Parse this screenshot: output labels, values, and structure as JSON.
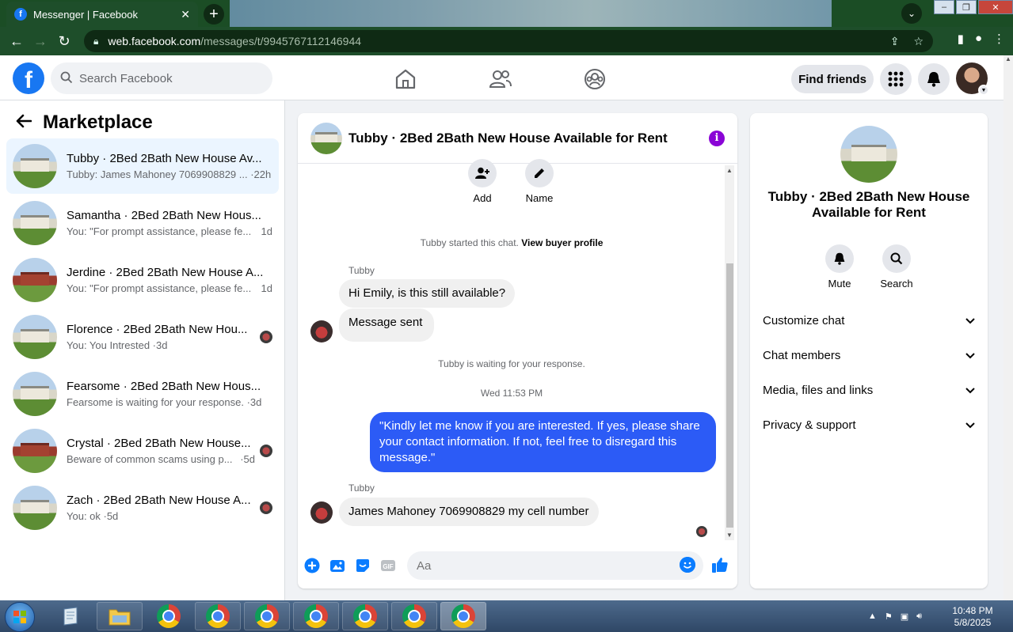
{
  "browser": {
    "tab_title": "Messenger | Facebook",
    "tab_favicon": "f",
    "url_host": "web.facebook.com",
    "url_path": "/messages/t/9945767112146944"
  },
  "fb_header": {
    "search_placeholder": "Search Facebook",
    "find_friends": "Find friends"
  },
  "sidebar": {
    "title": "Marketplace",
    "chats": [
      {
        "name": "Tubby · 2Bed 2Bath New House Av...",
        "preview": "Tubby: James Mahoney 7069908829 ... ·22h"
      },
      {
        "name": "Samantha · 2Bed 2Bath New Hous...",
        "preview": "You: \"For prompt assistance, please fe...",
        "time": "1d"
      },
      {
        "name": "Jerdine · 2Bed 2Bath New House A...",
        "preview": "You: \"For prompt assistance, please fe...",
        "time": "1d"
      },
      {
        "name": "Florence · 2Bed 2Bath New Hou...",
        "preview": "You: You Intrested ·3d"
      },
      {
        "name": "Fearsome · 2Bed 2Bath New Hous...",
        "preview": "Fearsome is waiting for your response. ·3d"
      },
      {
        "name": "Crystal · 2Bed 2Bath New House...",
        "preview": "Beware of common scams using p...",
        "time": "·5d"
      },
      {
        "name": "Zach · 2Bed 2Bath New House A...",
        "preview": "You: ok ·5d"
      }
    ]
  },
  "chat": {
    "title": "Tubby · 2Bed 2Bath New House Available for Rent",
    "add_label": "Add",
    "name_label": "Name",
    "started_text": "Tubby started this chat.",
    "buyer_profile": "View buyer profile",
    "sender1": "Tubby",
    "msg1": "Hi Emily, is this still available?",
    "msg2": "Message sent",
    "waiting": "Tubby is waiting for your response.",
    "timestamp": "Wed 11:53 PM",
    "out_msg": "\"Kindly let me know if you are interested. If yes, please share your contact information. If not, feel free to disregard this message.\"",
    "sender2": "Tubby",
    "msg3": "James Mahoney 7069908829 my cell number",
    "composer_placeholder": "Aa"
  },
  "info": {
    "title": "Tubby · 2Bed 2Bath New House Available for Rent",
    "mute": "Mute",
    "search": "Search",
    "rows": [
      "Customize chat",
      "Chat members",
      "Media, files and links",
      "Privacy & support"
    ]
  },
  "taskbar": {
    "time": "10:48 PM",
    "date": "5/8/2025"
  },
  "colors": {
    "fb_blue": "#1877f2",
    "outgoing_bubble": "#2c5bf6",
    "info_icon": "#8a04d6",
    "active_chat_bg": "#ebf5ff"
  }
}
